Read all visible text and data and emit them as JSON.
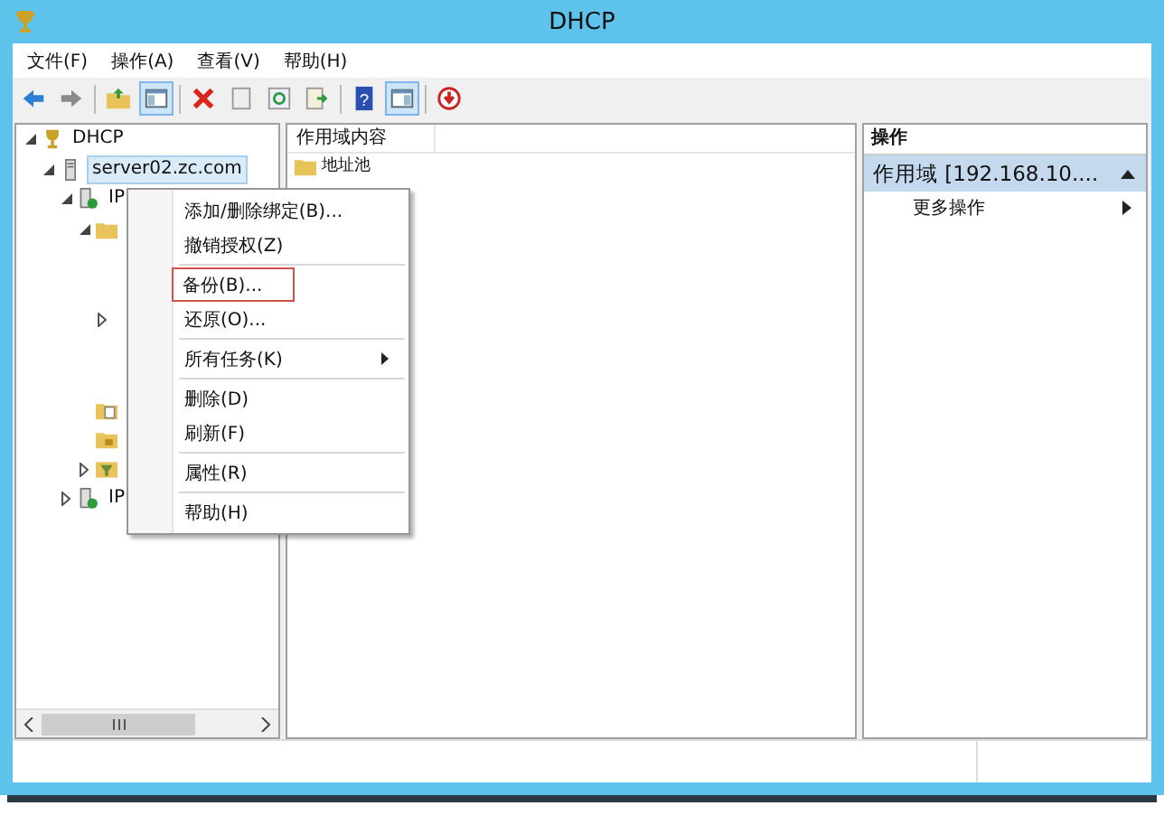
{
  "window": {
    "title": "DHCP"
  },
  "menu_bar": [
    "文件(F)",
    "操作(A)",
    "查看(V)",
    "帮助(H)"
  ],
  "toolbar": {
    "help_glyph": "?"
  },
  "tree": [
    {
      "label": "DHCP",
      "kind": "root",
      "expanded": true,
      "children": [
        {
          "label": "server02.zc.com",
          "kind": "server",
          "selected": true,
          "expanded": true,
          "children": [
            {
              "label": "IP",
              "kind": "protocol",
              "expanded": true,
              "children": [
                {
                  "kind": "folder",
                  "expanded": true,
                  "children": [
                    {
                      "kind": "covered"
                    },
                    {
                      "kind": "covered"
                    },
                    {
                      "kind": "covered",
                      "expanded": false
                    },
                    {
                      "kind": "covered"
                    },
                    {
                      "kind": "covered"
                    }
                  ]
                },
                {
                  "kind": "folder-doc"
                },
                {
                  "kind": "folder-lock"
                },
                {
                  "kind": "filter",
                  "expanded": false
                }
              ]
            },
            {
              "label": "IP",
              "kind": "protocol",
              "expanded": false
            }
          ]
        }
      ]
    }
  ],
  "content": {
    "column": "作用域内容",
    "rows": [
      {
        "label": "地址池"
      }
    ]
  },
  "actions": {
    "header": "操作",
    "section": "作用域 [192.168.10....",
    "items": [
      {
        "label": "更多操作",
        "submenu": true
      }
    ]
  },
  "context_menu": [
    {
      "kind": "item",
      "label": "添加/删除绑定(B)...",
      "highlighted": false,
      "submenu": false
    },
    {
      "kind": "item",
      "label": "撤销授权(Z)",
      "highlighted": false,
      "submenu": false
    },
    {
      "kind": "separator"
    },
    {
      "kind": "item",
      "label": "备份(B)...",
      "highlighted": true,
      "submenu": false
    },
    {
      "kind": "item",
      "label": "还原(O)...",
      "highlighted": false,
      "submenu": false
    },
    {
      "kind": "separator"
    },
    {
      "kind": "item",
      "label": "所有任务(K)",
      "highlighted": false,
      "submenu": true
    },
    {
      "kind": "separator"
    },
    {
      "kind": "item",
      "label": "删除(D)",
      "highlighted": false,
      "submenu": false
    },
    {
      "kind": "item",
      "label": "刷新(F)",
      "highlighted": false,
      "submenu": false
    },
    {
      "kind": "separator"
    },
    {
      "kind": "item",
      "label": "属性(R)",
      "highlighted": false,
      "submenu": false
    },
    {
      "kind": "separator"
    },
    {
      "kind": "item",
      "label": "帮助(H)",
      "highlighted": false,
      "submenu": false
    }
  ]
}
